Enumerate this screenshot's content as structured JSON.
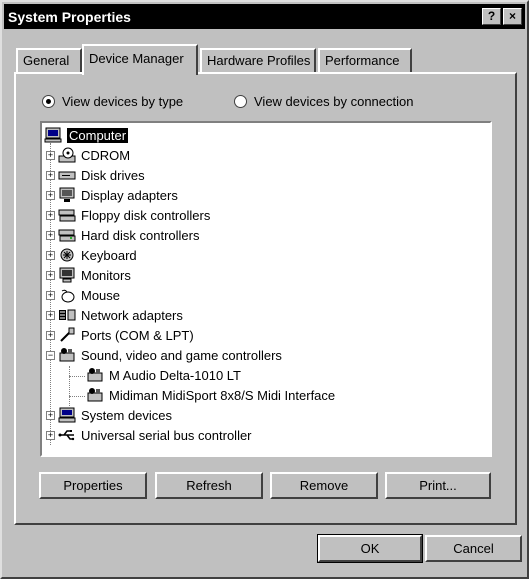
{
  "window": {
    "title": "System Properties",
    "help_button": "?",
    "close_button": "×"
  },
  "tabs": [
    {
      "label": "General"
    },
    {
      "label": "Device Manager"
    },
    {
      "label": "Hardware Profiles"
    },
    {
      "label": "Performance"
    }
  ],
  "view_options": {
    "by_type": "View devices by type",
    "by_connection": "View devices by connection"
  },
  "tree": {
    "root": "Computer",
    "items": [
      {
        "label": "CDROM",
        "icon": "cdrom-icon"
      },
      {
        "label": "Disk drives",
        "icon": "disk-drive-icon"
      },
      {
        "label": "Display adapters",
        "icon": "display-adapter-icon"
      },
      {
        "label": "Floppy disk controllers",
        "icon": "floppy-controller-icon"
      },
      {
        "label": "Hard disk controllers",
        "icon": "hard-disk-controller-icon"
      },
      {
        "label": "Keyboard",
        "icon": "keyboard-icon"
      },
      {
        "label": "Monitors",
        "icon": "monitor-icon"
      },
      {
        "label": "Mouse",
        "icon": "mouse-icon"
      },
      {
        "label": "Network adapters",
        "icon": "network-adapter-icon"
      },
      {
        "label": "Ports (COM & LPT)",
        "icon": "port-icon"
      },
      {
        "label": "Sound, video and game controllers",
        "icon": "sound-controller-icon"
      },
      {
        "label": "M Audio Delta-1010 LT",
        "icon": "sound-device-icon"
      },
      {
        "label": "Midiman MidiSport 8x8/S Midi Interface",
        "icon": "sound-device-icon"
      },
      {
        "label": "System devices",
        "icon": "system-device-icon"
      },
      {
        "label": "Universal serial bus controller",
        "icon": "usb-icon"
      }
    ]
  },
  "panel_buttons": {
    "properties": "Properties",
    "refresh": "Refresh",
    "remove": "Remove",
    "print": "Print..."
  },
  "dialog_buttons": {
    "ok": "OK",
    "cancel": "Cancel"
  }
}
